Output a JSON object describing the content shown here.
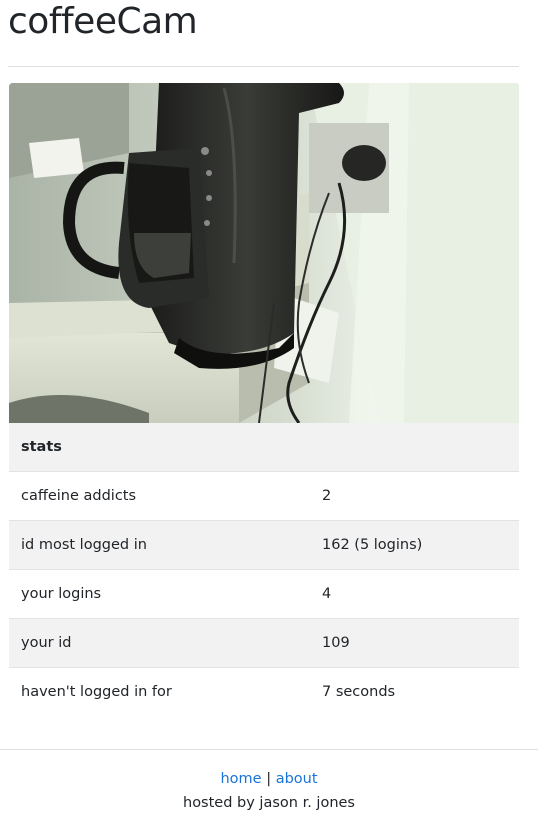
{
  "header": {
    "title": "coffeeCam"
  },
  "camera": {
    "alt": "coffee maker webcam feed"
  },
  "stats": {
    "heading": "stats",
    "rows": [
      {
        "label": "caffeine addicts",
        "value": "2"
      },
      {
        "label": "id most logged in",
        "value": "162 (5 logins)"
      },
      {
        "label": "your logins",
        "value": "4"
      },
      {
        "label": "your id",
        "value": "109"
      },
      {
        "label": "haven't logged in for",
        "value": "7 seconds"
      }
    ]
  },
  "footer": {
    "home_label": "home",
    "separator": "|",
    "about_label": "about",
    "hosted_by": "hosted by jason r. jones"
  }
}
